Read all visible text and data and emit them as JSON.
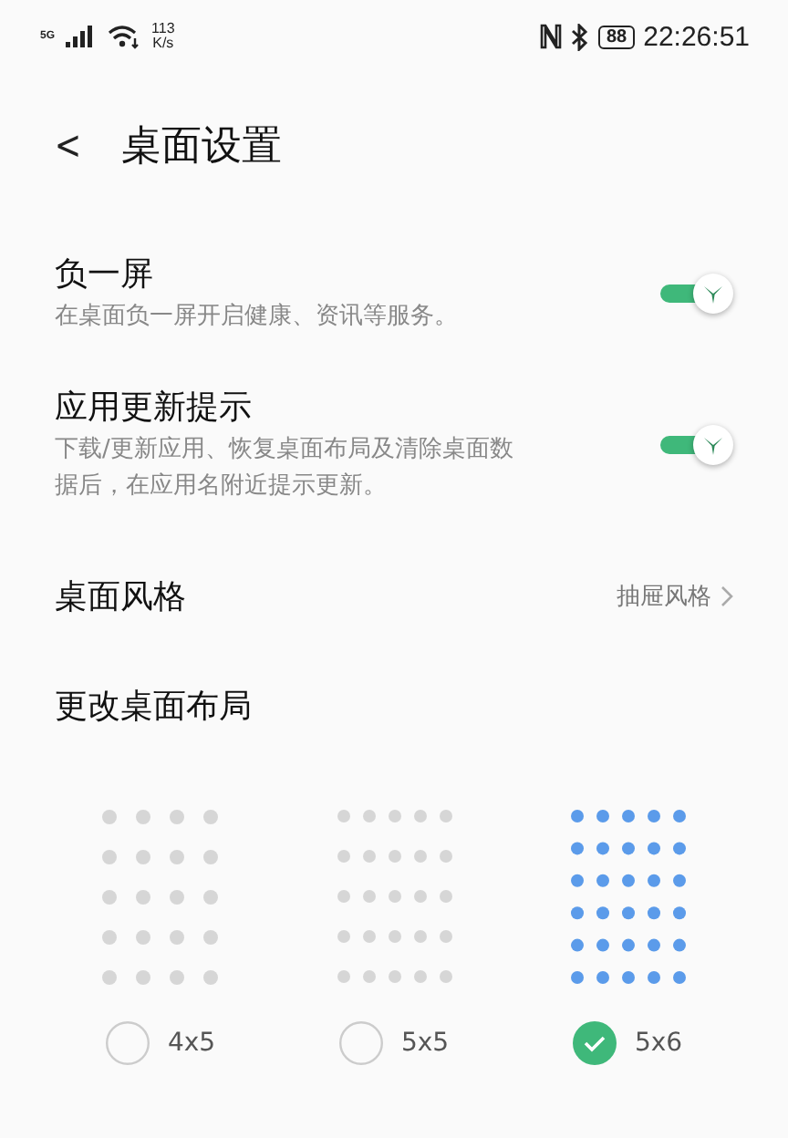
{
  "status_bar": {
    "network": "5G",
    "speed_value": "113",
    "speed_unit": "K/s",
    "battery": "88",
    "time": "22:26:51"
  },
  "header": {
    "back": "<",
    "title": "桌面设置"
  },
  "settings": [
    {
      "kind": "toggle",
      "title": "负一屏",
      "description": "在桌面负一屏开启健康、资讯等服务。",
      "on": true
    },
    {
      "kind": "toggle",
      "title": "应用更新提示",
      "description": "下载/更新应用、恢复桌面布局及清除桌面数据后，在应用名附近提示更新。",
      "on": true
    },
    {
      "kind": "link",
      "title": "桌面风格",
      "value": "抽屉风格"
    },
    {
      "kind": "heading",
      "title": "更改桌面布局"
    }
  ],
  "layouts": [
    {
      "label": "4x5",
      "selected": false
    },
    {
      "label": "5x5",
      "selected": false
    },
    {
      "label": "5x6",
      "selected": true
    }
  ]
}
